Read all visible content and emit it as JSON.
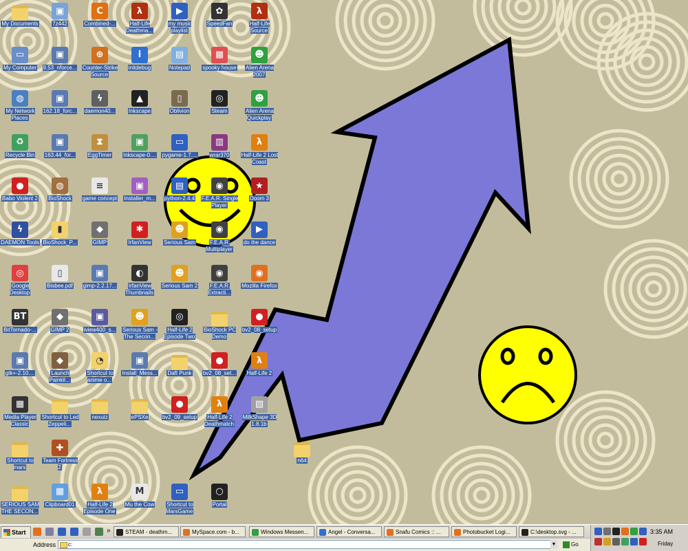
{
  "desktop": {
    "colors": {
      "background": "#c2bc9c",
      "swirl": "#ece5c9",
      "arrow_fill": "#7b78d8",
      "arrow_stroke": "#000000",
      "smiley": "#ffff00",
      "label_bg": "#3a5fa0"
    },
    "icons": [
      {
        "label": "My Documents",
        "icon": "folder-docs-icon",
        "color": "#f3d26b"
      },
      {
        "label": "7z442",
        "icon": "installer-icon",
        "color": "#7aa3d8"
      },
      {
        "label": "Combined-...",
        "icon": "c-logo-icon",
        "color": "#e07010"
      },
      {
        "label": "Half-Life Deathma...",
        "icon": "half-life-icon",
        "color": "#b03010"
      },
      {
        "label": "my music playlist",
        "icon": "media-playlist-icon",
        "color": "#3060c0"
      },
      {
        "label": "SpeedFan",
        "icon": "speedfan-icon",
        "color": "#333333"
      },
      {
        "label": "Half-Life Source",
        "icon": "half-life-icon",
        "color": "#b03010"
      },
      {
        "label": "My Computer",
        "icon": "computer-icon",
        "color": "#6a8fc8"
      },
      {
        "label": "9.53_nforce...",
        "icon": "installer-icon",
        "color": "#5a7ab0"
      },
      {
        "label": "Counter-Strike Source",
        "icon": "counter-strike-icon",
        "color": "#d07020"
      },
      {
        "label": "initdebug",
        "icon": "info-icon",
        "color": "#3070d0"
      },
      {
        "label": "Notepad",
        "icon": "notepad-icon",
        "color": "#80b0e0"
      },
      {
        "label": "spooky house",
        "icon": "image-file-icon",
        "color": "#e05050"
      },
      {
        "label": "Alien Arena 2007",
        "icon": "alien-arena-icon",
        "color": "#30a040"
      },
      {
        "label": "My Network Places",
        "icon": "network-icon",
        "color": "#4a80c0"
      },
      {
        "label": "162.18_forc...",
        "icon": "installer-icon",
        "color": "#5a7ab0"
      },
      {
        "label": "daemon40...",
        "icon": "daemon-tools-icon",
        "color": "#606060"
      },
      {
        "label": "Inkscape",
        "icon": "inkscape-icon",
        "color": "#222222"
      },
      {
        "label": "Oblivion",
        "icon": "oblivion-icon",
        "color": "#7a6a50"
      },
      {
        "label": "Steam",
        "icon": "steam-icon",
        "color": "#222222"
      },
      {
        "label": "Alien Arena Quickplay",
        "icon": "alien-arena-icon",
        "color": "#30a040"
      },
      {
        "label": "Recycle Bin",
        "icon": "recycle-bin-icon",
        "color": "#40a060"
      },
      {
        "label": "163.44_for...",
        "icon": "installer-icon",
        "color": "#5a7ab0"
      },
      {
        "label": "EggTimer",
        "icon": "hourglass-icon",
        "color": "#c09040"
      },
      {
        "label": "Inkscape-0....",
        "icon": "installer-icon",
        "color": "#50a060"
      },
      {
        "label": "pygame-1.7....",
        "icon": "window-icon",
        "color": "#3060c0"
      },
      {
        "label": "wrar370",
        "icon": "winrar-icon",
        "color": "#8a3a80"
      },
      {
        "label": "Half-Life 2 Lost Coast",
        "icon": "half-life-icon",
        "color": "#e08010"
      },
      {
        "label": "Babo Violent 2",
        "icon": "babo-icon",
        "color": "#d02020"
      },
      {
        "label": "BioShock",
        "icon": "bioshock-icon",
        "color": "#a07040"
      },
      {
        "label": "game concept",
        "icon": "text-file-icon",
        "color": "#e8e8e8"
      },
      {
        "label": "Installer_m...",
        "icon": "installer-icon",
        "color": "#a060c0"
      },
      {
        "label": "python-2.4.4",
        "icon": "python-icon",
        "color": "#3060c0"
      },
      {
        "label": "F.E.A.R. Single Player",
        "icon": "fear-icon",
        "color": "#404040"
      },
      {
        "label": "Doom 3",
        "icon": "doom-icon",
        "color": "#b02020"
      },
      {
        "label": "DAEMON Tools",
        "icon": "daemon-tools-icon",
        "color": "#3050a0"
      },
      {
        "label": "BioShock_P...",
        "icon": "zip-folder-icon",
        "color": "#f3d26b"
      },
      {
        "label": "GIMP",
        "icon": "gimp-icon",
        "color": "#707070"
      },
      {
        "label": "IrfanView",
        "icon": "irfanview-icon",
        "color": "#d02020"
      },
      {
        "label": "Serious Sam",
        "icon": "serious-sam-icon",
        "color": "#e0a020"
      },
      {
        "label": "F.E.A.R. Multiplayer",
        "icon": "fear-icon",
        "color": "#404040"
      },
      {
        "label": "do the dance",
        "icon": "media-playlist-icon",
        "color": "#3060c0"
      },
      {
        "label": "Google Desktop",
        "icon": "google-desktop-icon",
        "color": "#e04040"
      },
      {
        "label": "Bisbee.pdf",
        "icon": "pdf-icon",
        "color": "#e8e8e8"
      },
      {
        "label": "gimp-2.2.17...",
        "icon": "installer-icon",
        "color": "#5a7ab0"
      },
      {
        "label": "IrfanView Thumbnails",
        "icon": "panda-icon",
        "color": "#333333"
      },
      {
        "label": "Serious Sam 2",
        "icon": "serious-sam-icon",
        "color": "#e0a020"
      },
      {
        "label": "F.E.A.R. Extracti...",
        "icon": "fear-icon",
        "color": "#404040"
      },
      {
        "label": "Mozilla Firefox",
        "icon": "firefox-icon",
        "color": "#e07020"
      },
      {
        "label": "BitTornado-...",
        "icon": "bittornado-icon",
        "color": "#333333"
      },
      {
        "label": "GIMP 2",
        "icon": "gimp-icon",
        "color": "#707070"
      },
      {
        "label": "iview400_s...",
        "icon": "installer-icon",
        "color": "#5a5aa0"
      },
      {
        "label": "Serious Sam - The Secon...",
        "icon": "serious-sam-icon",
        "color": "#e0a020"
      },
      {
        "label": "Half-Life 2 Episode Two",
        "icon": "steam-icon",
        "color": "#222222"
      },
      {
        "label": "BioShock PC Demo",
        "icon": "folder-icon",
        "color": "#f3d26b"
      },
      {
        "label": "bv2_08_setup",
        "icon": "babo-icon",
        "color": "#d02020"
      },
      {
        "label": "gtk+-2.10....",
        "icon": "installer-icon",
        "color": "#5a7ab0"
      },
      {
        "label": "Launch Painkil...",
        "icon": "painkiller-icon",
        "color": "#806040"
      },
      {
        "label": "Shortcut to anime o...",
        "icon": "search-folder-icon",
        "color": "#f3d26b"
      },
      {
        "label": "Install_Mess...",
        "icon": "installer-icon",
        "color": "#5a7ab0"
      },
      {
        "label": "Daft Punk",
        "icon": "folder-icon",
        "color": "#f3d26b"
      },
      {
        "label": "bv2_08_set...",
        "icon": "babo-icon",
        "color": "#d02020"
      },
      {
        "label": "Half-Life 2",
        "icon": "half-life-icon",
        "color": "#e08010"
      },
      {
        "label": "Media Player Classic",
        "icon": "clapperboard-icon",
        "color": "#333333"
      },
      {
        "label": "Shortcut to Led Zeppeli...",
        "icon": "folder-icon",
        "color": "#f3d26b"
      },
      {
        "label": "nexuiz",
        "icon": "folder-icon",
        "color": "#f3d26b"
      },
      {
        "label": "ePSXe",
        "icon": "folder-icon",
        "color": "#f3d26b"
      },
      {
        "label": "bv2_09_setup",
        "icon": "babo-icon",
        "color": "#d02020"
      },
      {
        "label": "Half-Life 2 Deathmatch",
        "icon": "half-life-icon",
        "color": "#e08010"
      },
      {
        "label": "MilkShape 3D 1.8.1b",
        "icon": "milkshape-icon",
        "color": "#a0a0a0"
      },
      {
        "label": "Shortcut to mars",
        "icon": "folder-icon",
        "color": "#f3d26b"
      },
      {
        "label": "Team Fortress 2",
        "icon": "team-fortress-icon",
        "color": "#b05020"
      },
      {
        "label": "n64",
        "icon": "folder-icon",
        "color": "#f3d26b"
      },
      {
        "label": "SERIOUS SAM THE SECON...",
        "icon": "folder-icon",
        "color": "#f3d26b"
      },
      {
        "label": "Clipboard01",
        "icon": "image-file-icon",
        "color": "#60a0e0"
      },
      {
        "label": "Half-Life 2 Episode One",
        "icon": "half-life-icon",
        "color": "#e08010"
      },
      {
        "label": "Mu the Cow",
        "icon": "cow-icon",
        "color": "#e8e8e8"
      },
      {
        "label": "Shortcut to MarsGame",
        "icon": "window-icon",
        "color": "#3060c0"
      },
      {
        "label": "Portal",
        "icon": "portal-icon",
        "color": "#222222"
      }
    ],
    "glyphs": {
      "half-life-icon": "λ",
      "c-logo-icon": "C",
      "info-icon": "i",
      "bittornado-icon": "BT",
      "steam-icon": "◎",
      "babo-icon": "●",
      "doom-icon": "★",
      "portal-icon": "○",
      "firefox-icon": "◉",
      "gimp-icon": "◆",
      "counter-strike-icon": "⊕",
      "hourglass-icon": "⧗",
      "python-icon": "▤",
      "fear-icon": "◉",
      "serious-sam-icon": "☻",
      "irfanview-icon": "✱",
      "team-fortress-icon": "✚",
      "pdf-icon": "▯",
      "text-file-icon": "≡",
      "media-playlist-icon": "▶",
      "clapperboard-icon": "▦",
      "cow-icon": "M",
      "daemon-tools-icon": "ϟ",
      "google-desktop-icon": "◎",
      "bioshock-icon": "◍",
      "alien-arena-icon": "☻",
      "oblivion-icon": "▯",
      "inkscape-icon": "▲",
      "speedfan-icon": "✿",
      "panda-icon": "◐",
      "recycle-bin-icon": "♻",
      "network-icon": "◍",
      "computer-icon": "▭",
      "window-icon": "▭",
      "installer-icon": "▣",
      "notepad-icon": "▤",
      "winrar-icon": "▥",
      "painkiller-icon": "◆",
      "search-folder-icon": "◔",
      "milkshape-icon": "▧",
      "image-file-icon": "▦",
      "zip-folder-icon": "▮",
      "folder-icon": "",
      "folder-docs-icon": ""
    }
  },
  "taskbar": {
    "start_label": "Start",
    "quick_launch": [
      {
        "icon": "firefox-icon",
        "color": "#e07020"
      },
      {
        "icon": "cd-icon",
        "color": "#8080a0"
      },
      {
        "icon": "media-player-icon",
        "color": "#3060c0"
      },
      {
        "icon": "media-player-icon",
        "color": "#3060c0"
      },
      {
        "icon": "document-icon",
        "color": "#a0a0a0"
      },
      {
        "icon": "show-desktop-icon",
        "color": "#508050"
      }
    ],
    "overflow_label": "»",
    "tasks": [
      {
        "label": "STEAM - deathm...",
        "icon": "steam-icon",
        "color": "#222222"
      },
      {
        "label": "MySpace.com - b...",
        "icon": "firefox-icon",
        "color": "#e07020"
      },
      {
        "label": "Windows Messen...",
        "icon": "messenger-icon",
        "color": "#30a040"
      },
      {
        "label": "Angel - Conversa...",
        "icon": "conversation-icon",
        "color": "#3070d0"
      },
      {
        "label": "Snafu Comics :: ...",
        "icon": "firefox-icon",
        "color": "#e07020"
      },
      {
        "label": "Photobucket Logi...",
        "icon": "firefox-icon",
        "color": "#e07020"
      },
      {
        "label": "C:\\desktop.svg - ...",
        "icon": "inkscape-icon",
        "color": "#222222"
      }
    ],
    "tray_icons": [
      {
        "icon": "network-tray-icon",
        "color": "#3060c0"
      },
      {
        "icon": "speaker-tray-icon",
        "color": "#707070"
      },
      {
        "icon": "steam-tray-icon",
        "color": "#222222"
      },
      {
        "icon": "xfire-tray-icon",
        "color": "#e07020"
      },
      {
        "icon": "messenger-tray-icon",
        "color": "#30a040"
      },
      {
        "icon": "monitor-tray-icon",
        "color": "#3060c0"
      },
      {
        "icon": "security-tray-icon",
        "color": "#c03030"
      },
      {
        "icon": "update-tray-icon",
        "color": "#d0a020"
      },
      {
        "icon": "device-tray-icon",
        "color": "#606060"
      },
      {
        "icon": "power-tray-icon",
        "color": "#40a060"
      },
      {
        "icon": "display-tray-icon",
        "color": "#3060c0"
      },
      {
        "icon": "antivirus-tray-icon",
        "color": "#d02020"
      }
    ],
    "clock": "3:35 AM",
    "day": "Friday"
  },
  "address_bar": {
    "label": "Address",
    "value": "c:",
    "go_label": "Go"
  }
}
